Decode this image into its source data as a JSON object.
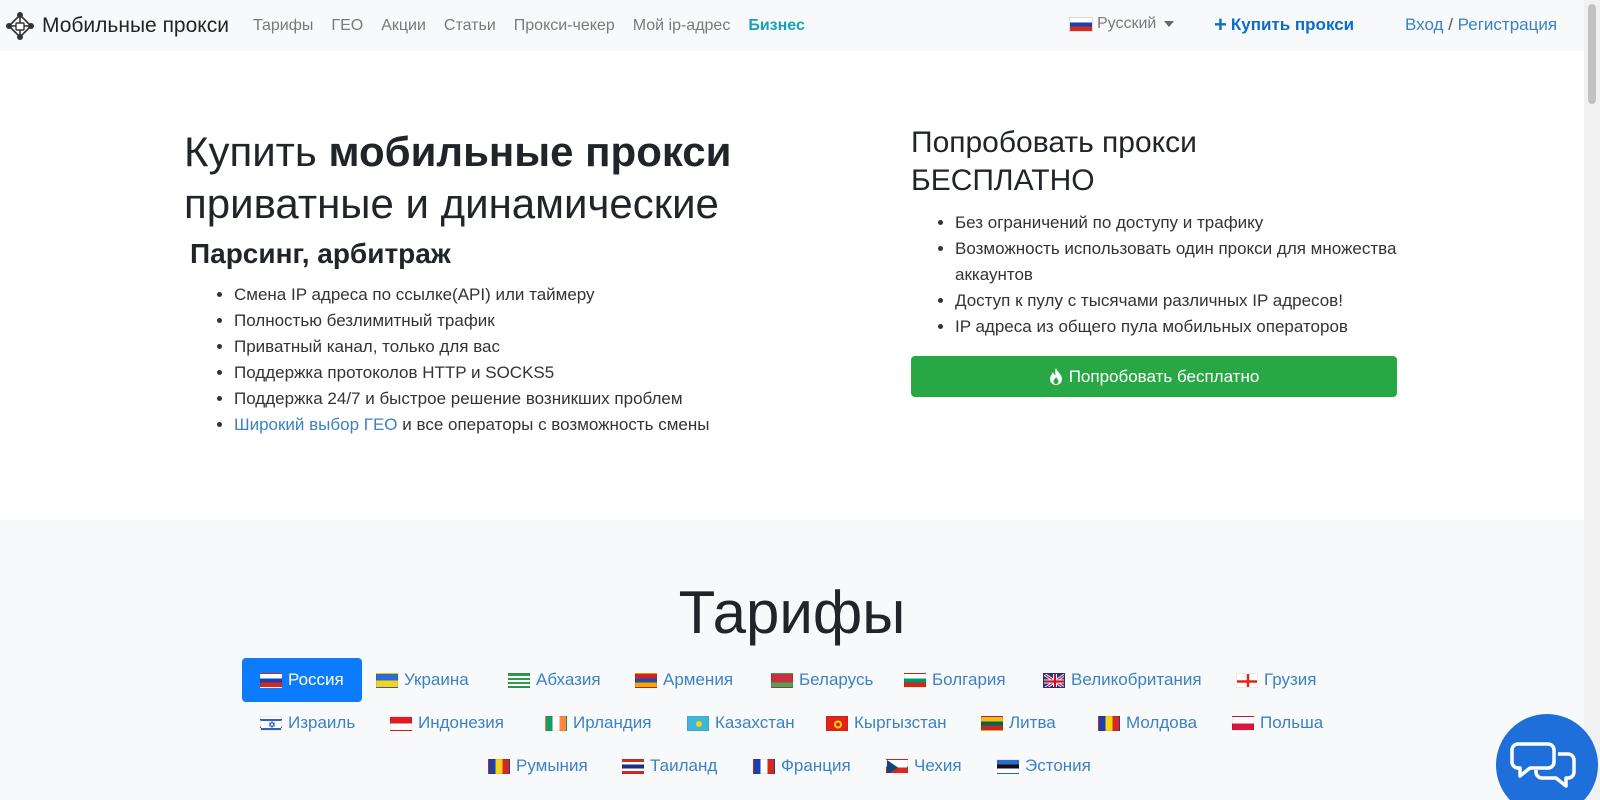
{
  "brand": {
    "name": "Мобильные прокси"
  },
  "nav": {
    "links": [
      "Тарифы",
      "ГЕО",
      "Акции",
      "Статьи",
      "Прокси-чекер",
      "Мой ip-адрес",
      "Бизнес"
    ],
    "language": "Русский",
    "buy_label": "Купить прокси",
    "login": "Вход",
    "separator": "/",
    "register": "Регистрация"
  },
  "hero": {
    "title_normal": "Купить ",
    "title_bold": "мобильные прокси",
    "title_line2": "приватные и динамические",
    "subtitle": "Парсинг, арбитраж",
    "features": [
      "Смена IP адреса по ссылке(API) или таймеру",
      "Полностью безлимитный трафик",
      "Приватный канал, только для вас",
      "Поддержка протоколов HTTP и SOCKS5",
      "Поддержка 24/7 и быстрое решение возникших проблем"
    ],
    "geo_link": "Широкий выбор ГЕО",
    "geo_rest": " и все операторы с возможность смены"
  },
  "trial": {
    "title_line1": "Попробовать прокси",
    "title_line2": "БЕСПЛАТНО",
    "items": [
      "Без ограничений по доступу и трафику",
      "Возможность использовать один прокси для множества аккаунтов",
      "Доступ к пулу с тысячами различных IP адресов!",
      "IP адреса из общего пула мобильных операторов"
    ],
    "button_label": "Попробовать бесплатно"
  },
  "tariffs": {
    "title": "Тарифы",
    "countries": [
      {
        "name": "Россия",
        "flag": "ru",
        "active": true
      },
      {
        "name": "Украина",
        "flag": "ua"
      },
      {
        "name": "Абхазия",
        "flag": "abh"
      },
      {
        "name": "Армения",
        "flag": "am"
      },
      {
        "name": "Беларусь",
        "flag": "by"
      },
      {
        "name": "Болгария",
        "flag": "bg"
      },
      {
        "name": "Великобритания",
        "flag": "gb"
      },
      {
        "name": "Грузия",
        "flag": "ge"
      },
      {
        "name": "Израиль",
        "flag": "il"
      },
      {
        "name": "Индонезия",
        "flag": "id"
      },
      {
        "name": "Ирландия",
        "flag": "ie"
      },
      {
        "name": "Казахстан",
        "flag": "kz"
      },
      {
        "name": "Кыргызстан",
        "flag": "kg"
      },
      {
        "name": "Литва",
        "flag": "lt"
      },
      {
        "name": "Молдова",
        "flag": "md"
      },
      {
        "name": "Польша",
        "flag": "pl"
      },
      {
        "name": "Румыния",
        "flag": "ro"
      },
      {
        "name": "Таиланд",
        "flag": "th"
      },
      {
        "name": "Франция",
        "flag": "fr"
      },
      {
        "name": "Чехия",
        "flag": "cz"
      },
      {
        "name": "Эстония",
        "flag": "ee"
      }
    ]
  },
  "colors": {
    "accent": "#0d7bfd",
    "success": "#28a745",
    "link": "#3b82c4",
    "business": "#17a2b8"
  },
  "icons": {
    "logo": "network-nodes-icon",
    "plus": "plus-icon",
    "fire": "fire-icon",
    "chat": "chat-bubbles-icon"
  }
}
